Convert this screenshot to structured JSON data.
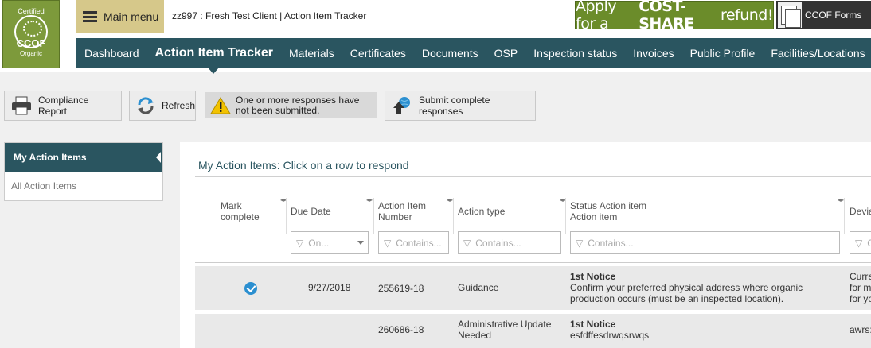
{
  "logo": {
    "top": "Certified",
    "main": "CCOF",
    "bottom": "Organic"
  },
  "header": {
    "main_menu_label": "Main menu",
    "breadcrumb": "zz997 : Fresh Test Client | Action Item Tracker",
    "banner": {
      "prefix": "Apply for a",
      "bold": "COST-SHARE",
      "suffix": "refund!"
    },
    "forms_label": "CCOF Forms"
  },
  "nav": {
    "items": [
      "Dashboard",
      "Action Item Tracker",
      "Materials",
      "Certificates",
      "Documents",
      "OSP",
      "Inspection status",
      "Invoices",
      "Public Profile",
      "Facilities/Locations"
    ],
    "active": "Action Item Tracker"
  },
  "toolbar": {
    "compliance_report": "Compliance Report",
    "refresh": "Refresh",
    "warning_line1": "One or more responses have",
    "warning_line2": "not been submitted.",
    "submit_line1": "Submit complete",
    "submit_line2": "responses"
  },
  "sidebar": {
    "items": [
      "My Action Items",
      "All Action Items"
    ]
  },
  "panel": {
    "title": "My Action Items: Click on a row to respond",
    "columns": [
      {
        "line1": "Mark",
        "line2": "complete"
      },
      {
        "line1": "Due Date",
        "line2": ""
      },
      {
        "line1": "Action Item",
        "line2": "Number"
      },
      {
        "line1": "Action type",
        "line2": ""
      },
      {
        "line1": "Status Action item",
        "line2": "Action item"
      },
      {
        "line1": "Devia",
        "line2": ""
      }
    ],
    "filters": {
      "due_date": "On...",
      "number": "Contains...",
      "type": "Contains...",
      "status": "Contains...",
      "deviation": "C"
    },
    "rows": [
      {
        "complete": true,
        "due_date": "9/27/2018",
        "number": "255619-18",
        "type": "Guidance",
        "notice": "1st Notice",
        "desc_line1": "Confirm your preferred physical address where organic",
        "desc_line2": "production occurs (must be an inspected location).",
        "dev_line1": "Curre",
        "dev_line2": "for m",
        "dev_line3": "for yo"
      },
      {
        "complete": false,
        "due_date": "",
        "number": "260686-18",
        "type_line1": "Administrative Update",
        "type_line2": "Needed",
        "notice": "1st Notice",
        "desc_line1": "esfdffesdrwqsrwqs",
        "dev_line1": "awrs:"
      }
    ]
  },
  "colors": {
    "nav": "#2a5560",
    "menu": "#d6c88a",
    "brand_green": "#7d9a3b",
    "check_blue": "#2b8fd0"
  }
}
